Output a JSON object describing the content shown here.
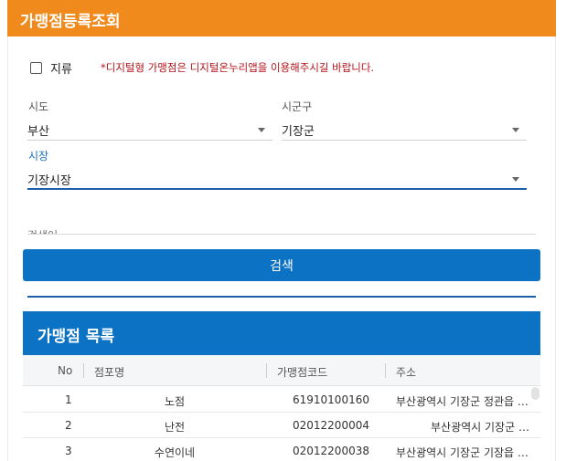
{
  "header": {
    "title": "가맹점등록조회"
  },
  "filter": {
    "checkbox_label": "지류",
    "notice": "*디지털형 가맹점은 디지털온누리앱을 이용해주시길 바랍니다."
  },
  "fields": {
    "sido": {
      "label": "시도",
      "value": "부산"
    },
    "sigungu": {
      "label": "시군구",
      "value": "기장군"
    },
    "market": {
      "label": "시장",
      "value": "기장시장"
    },
    "search_word": {
      "label": "검색어"
    }
  },
  "search_button": "검색",
  "list": {
    "title": "가맹점 목록",
    "columns": [
      "No",
      "점포명",
      "가맹점코드",
      "주소"
    ],
    "rows": [
      {
        "no": "1",
        "name": "노점",
        "code": "61910100160",
        "address": "부산광역시 기장군 정관읍 …"
      },
      {
        "no": "2",
        "name": "난전",
        "code": "02012200004",
        "address": "부산광역시 기장군 …"
      },
      {
        "no": "3",
        "name": "수연이네",
        "code": "02012200038",
        "address": "부산광역시 기장군 기장읍 …"
      }
    ]
  }
}
